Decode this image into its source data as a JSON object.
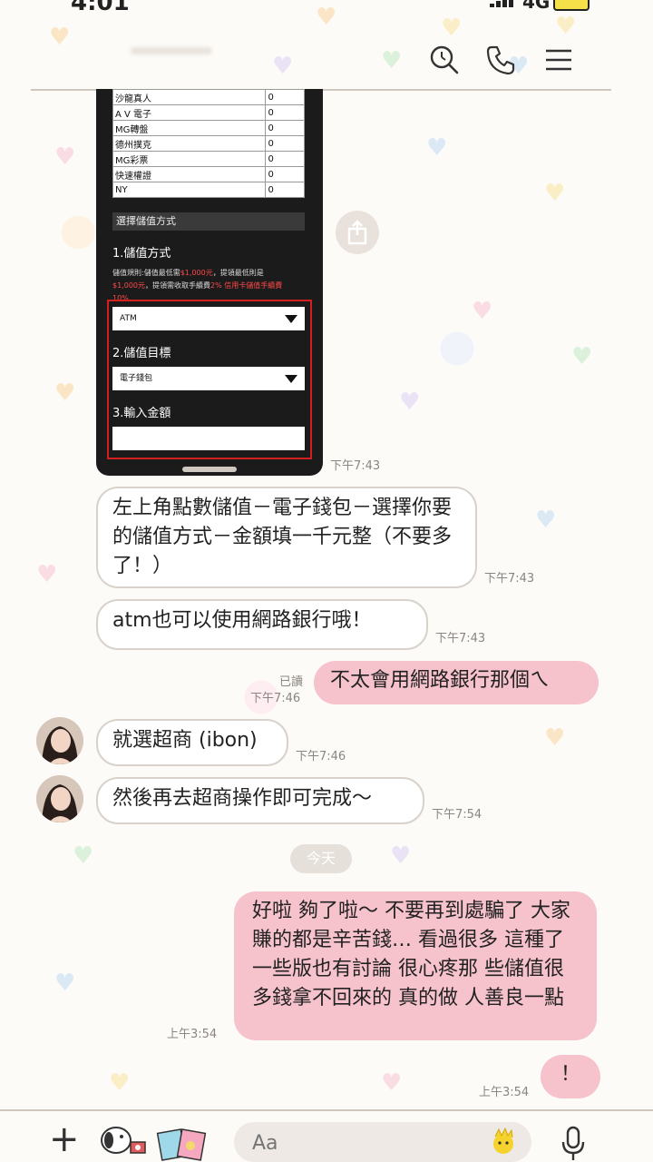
{
  "status": {
    "time": "4:01",
    "carrier": "4G"
  },
  "header": {
    "icons": [
      "search-icon",
      "phone-icon",
      "menu-icon"
    ]
  },
  "screenshot": {
    "rows": [
      [
        "沙龍真人",
        "0"
      ],
      [
        "A V 電子",
        "0"
      ],
      [
        "MG轉盤",
        "0"
      ],
      [
        "德州撲克",
        "0"
      ],
      [
        "MG彩票",
        "0"
      ],
      [
        "快速權證",
        "0"
      ],
      [
        "NY",
        "0"
      ]
    ],
    "section": "選擇儲值方式",
    "label1": "1.儲值方式",
    "rule_a": "儲值規則:儲值最低需",
    "rule_b": "$1,000元",
    "rule_c": "，提領最低則是",
    "rule_d": "$1,000元",
    "rule_e": "，提領需收取手續費",
    "rule_f": "2%",
    "rule_g": "信用卡儲值手續費",
    "rule_h": "10%",
    "select1": "ATM",
    "label2": "2.儲值目標",
    "select2": "電子錢包",
    "label3": "3.輸入金額"
  },
  "messages": [
    {
      "text": "左上角點數儲值－電子錢包－選擇你要的儲值方式－金額填一千元整（不要多了！）",
      "time": "下午7:43"
    },
    {
      "text": "atm也可以使用網路銀行哦！",
      "time": "下午7:43"
    },
    {
      "text": "不太會用網路銀行那個ㄟ",
      "time": "下午7:46",
      "read": "已讀"
    },
    {
      "text": "就選超商 (ibon)",
      "time": "下午7:46"
    },
    {
      "text": "然後再去超商操作即可完成～",
      "time": "下午7:54"
    },
    {
      "text": "好啦 夠了啦～ 不要再到處騙了 大家賺的都是辛苦錢… 看過很多 這種了 一些版也有討論 很心疼那 些儲值很多錢拿不回來的 真的做 人善良一點",
      "time": "上午3:54"
    },
    {
      "text": "！",
      "time": "上午3:54"
    }
  ],
  "shot_time": "下午7:43",
  "date_divider": "今天",
  "composer": {
    "placeholder": "Aa"
  }
}
